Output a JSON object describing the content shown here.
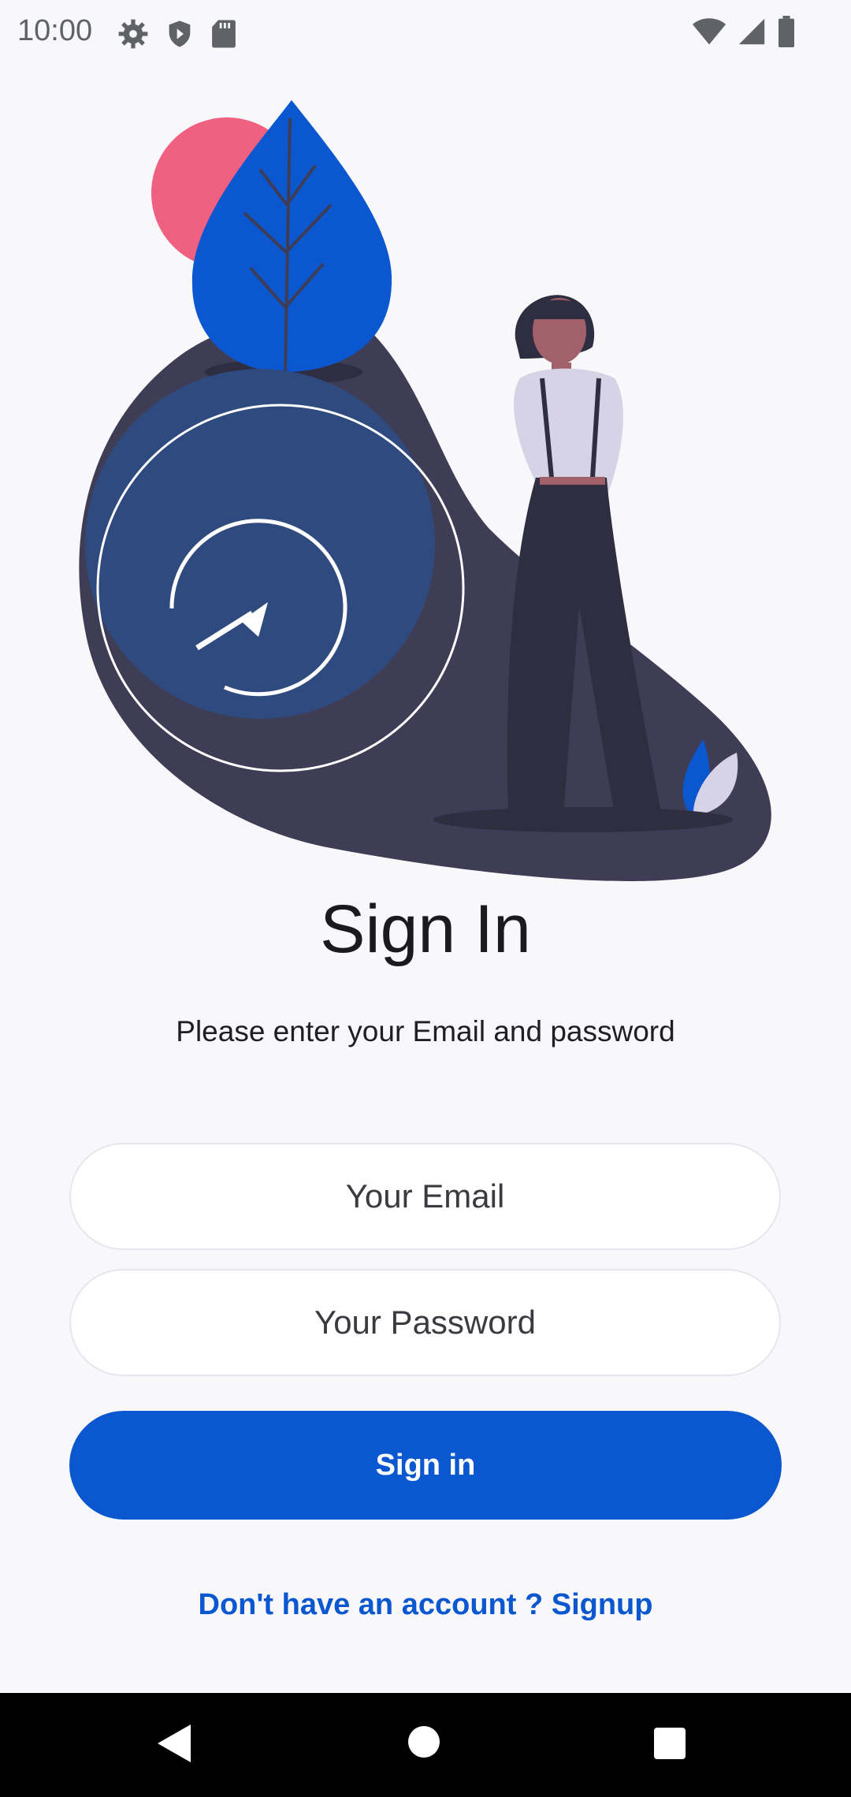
{
  "status_bar": {
    "time": "10:00",
    "left_icons": [
      "gear-icon",
      "shield-icon",
      "sd-card-icon"
    ],
    "right_icons": [
      "wifi-icon",
      "signal-icon",
      "battery-icon"
    ]
  },
  "illustration": {
    "name": "person-with-refresh-circle-and-leaf"
  },
  "header": {
    "title": "Sign In",
    "subtitle": "Please enter your Email and password"
  },
  "form": {
    "email_placeholder": "Your Email",
    "password_placeholder": "Your Password",
    "submit_label": "Sign in",
    "signup_text": "Don't have an account ? Signup"
  },
  "colors": {
    "primary": "#0b57d0",
    "background": "#f8f8fb",
    "blob": "#3f3d56",
    "circle": "#2f4a7f",
    "accent_pink": "#f06080"
  },
  "nav_bar": {
    "buttons": [
      "back-icon",
      "home-icon",
      "recents-icon"
    ]
  }
}
